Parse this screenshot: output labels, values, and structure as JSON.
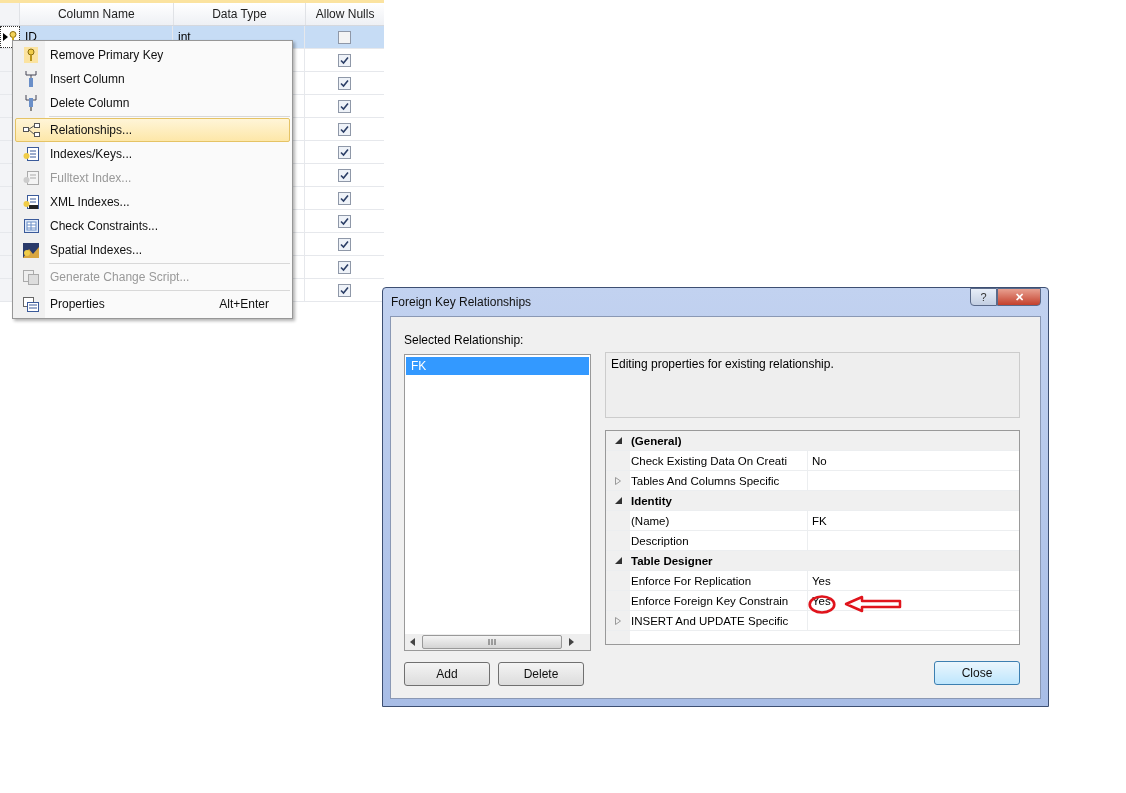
{
  "table": {
    "columns": [
      "Column Name",
      "Data Type",
      "Allow Nulls"
    ],
    "rows": [
      {
        "name": "ID",
        "type": "int",
        "allow_nulls": false,
        "selected": true,
        "primary_key": true
      },
      {
        "allow_nulls": true,
        "selected": false,
        "primary_key": false
      },
      {
        "allow_nulls": true,
        "selected": false,
        "primary_key": false
      },
      {
        "allow_nulls": true,
        "selected": false,
        "primary_key": false
      },
      {
        "allow_nulls": true,
        "selected": false,
        "primary_key": false
      },
      {
        "allow_nulls": true,
        "selected": false,
        "primary_key": false
      },
      {
        "allow_nulls": true,
        "selected": false,
        "primary_key": false
      },
      {
        "allow_nulls": true,
        "selected": false,
        "primary_key": false
      },
      {
        "allow_nulls": true,
        "selected": false,
        "primary_key": false
      },
      {
        "allow_nulls": true,
        "selected": false,
        "primary_key": false
      },
      {
        "allow_nulls": true,
        "selected": false,
        "primary_key": false
      },
      {
        "allow_nulls": true,
        "selected": false,
        "primary_key": false
      }
    ]
  },
  "context_menu": {
    "items": [
      {
        "kind": "item",
        "label": "Remove Primary Key",
        "disabled": false,
        "selected": false
      },
      {
        "kind": "item",
        "label": "Insert Column",
        "disabled": false,
        "selected": false
      },
      {
        "kind": "item",
        "label": "Delete Column",
        "disabled": false,
        "selected": false
      },
      {
        "kind": "separator"
      },
      {
        "kind": "item",
        "label": "Relationships...",
        "disabled": false,
        "selected": true
      },
      {
        "kind": "item",
        "label": "Indexes/Keys...",
        "disabled": false,
        "selected": false
      },
      {
        "kind": "item",
        "label": "Fulltext Index...",
        "disabled": true,
        "selected": false
      },
      {
        "kind": "item",
        "label": "XML Indexes...",
        "disabled": false,
        "selected": false
      },
      {
        "kind": "item",
        "label": "Check Constraints...",
        "disabled": false,
        "selected": false
      },
      {
        "kind": "item",
        "label": "Spatial Indexes...",
        "disabled": false,
        "selected": false
      },
      {
        "kind": "separator"
      },
      {
        "kind": "item",
        "label": "Generate Change Script...",
        "disabled": true,
        "selected": false
      },
      {
        "kind": "separator"
      },
      {
        "kind": "item",
        "label": "Properties",
        "shortcut": "Alt+Enter",
        "disabled": false,
        "selected": false
      }
    ]
  },
  "dialog": {
    "title": "Foreign Key Relationships",
    "help_button": "?",
    "close_button": "✕",
    "list_label": "Selected Relationship:",
    "relationships": [
      {
        "label": "FK",
        "selected": true
      }
    ],
    "description": "Editing properties for existing relationship.",
    "properties": [
      {
        "category": "(General)",
        "expanded": true,
        "items": [
          {
            "name": "Check Existing Data On Creati",
            "value": "No",
            "expandable": false,
            "annotated": false
          },
          {
            "name": "Tables And Columns Specific",
            "expandable": true,
            "annotated": false
          }
        ]
      },
      {
        "category": "Identity",
        "expanded": true,
        "items": [
          {
            "name": "(Name)",
            "value": "FK",
            "expandable": false,
            "annotated": false
          },
          {
            "name": "Description",
            "expandable": false,
            "annotated": false
          }
        ]
      },
      {
        "category": "Table Designer",
        "expanded": true,
        "items": [
          {
            "name": "Enforce For Replication",
            "value": "Yes",
            "expandable": false,
            "annotated": false
          },
          {
            "name": "Enforce Foreign Key Constrain",
            "value": "Yes",
            "expandable": false,
            "annotated": true
          },
          {
            "name": "INSERT And UPDATE Specific",
            "expandable": true,
            "annotated": false
          }
        ]
      }
    ],
    "buttons": {
      "add": "Add",
      "delete": "Delete",
      "close": "Close"
    }
  }
}
